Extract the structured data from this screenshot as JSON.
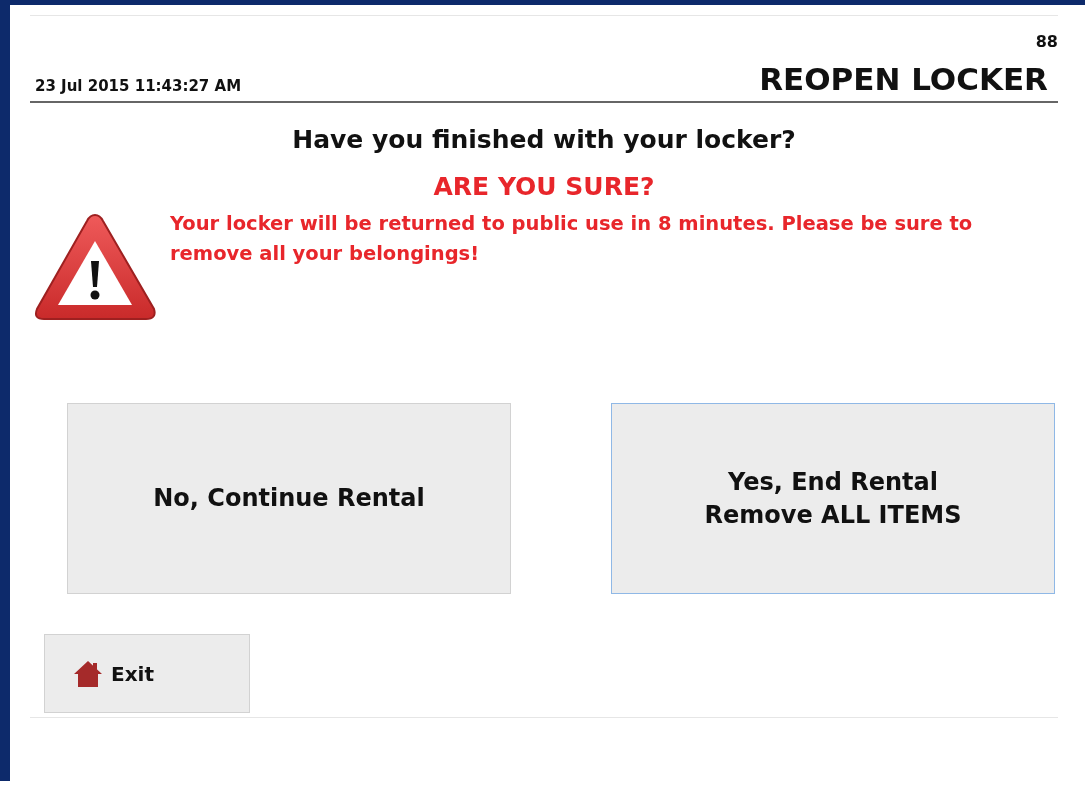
{
  "header": {
    "code": "88",
    "datetime": "23 Jul 2015 11:43:27 AM",
    "title": "REOPEN LOCKER"
  },
  "question": "Have you finished with your locker?",
  "warning": {
    "heading": "ARE YOU SURE?",
    "message": "Your locker will be returned to public use in 8 minutes. Please be sure to remove all your belongings!"
  },
  "buttons": [
    {
      "lines": [
        "No, Continue Rental"
      ],
      "focused": false
    },
    {
      "lines": [
        "Yes, End Rental",
        "Remove ALL ITEMS"
      ],
      "focused": true
    }
  ],
  "exit_button": {
    "label": "Exit"
  }
}
